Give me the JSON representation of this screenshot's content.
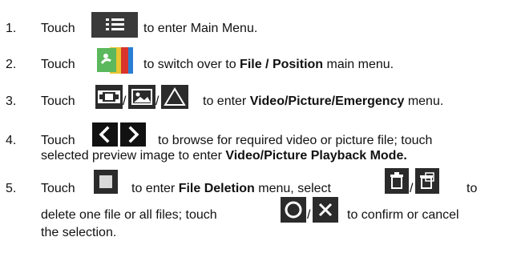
{
  "steps": [
    {
      "number": "1.",
      "touch": "Touch",
      "text": "to enter Main Menu.",
      "icons": [
        "main-menu-icon"
      ]
    },
    {
      "number": "2.",
      "touch": "Touch",
      "text_before": "to switch over to ",
      "bold": "File / Position",
      "text_after": " main menu.",
      "icons": [
        "file-position-icon"
      ]
    },
    {
      "number": "3.",
      "touch": "Touch",
      "text_before": "to enter ",
      "bold": "Video/Picture/Emergency",
      "text_after": " menu.",
      "icons": [
        "video-icon",
        "picture-icon",
        "emergency-icon"
      ],
      "sep": "/"
    },
    {
      "number": "4.",
      "touch": "Touch",
      "text_line1": "to browse for required video or picture file; touch",
      "text_line2_before": "selected preview image to enter ",
      "bold": "Video/Picture Playback Mode.",
      "icons": [
        "previous-icon",
        "next-icon"
      ]
    },
    {
      "number": "5.",
      "touch": "Touch",
      "text1_before": "to enter ",
      "bold": "File Deletion",
      "text1_after": " menu, select",
      "to": "to",
      "text2": "delete one file or all files; touch",
      "text3": "to confirm or cancel",
      "text4": "the selection.",
      "icons": [
        "delete-one-icon",
        "delete-all-icon",
        "confirm-icon",
        "cancel-icon"
      ],
      "sep": "/"
    }
  ],
  "colors": {
    "icon_dark": "#2b2b2b",
    "icon_green": "#5cb85c",
    "icon_red": "#d9342b",
    "icon_blue": "#2a7fd4",
    "icon_line": "#ffffff"
  }
}
